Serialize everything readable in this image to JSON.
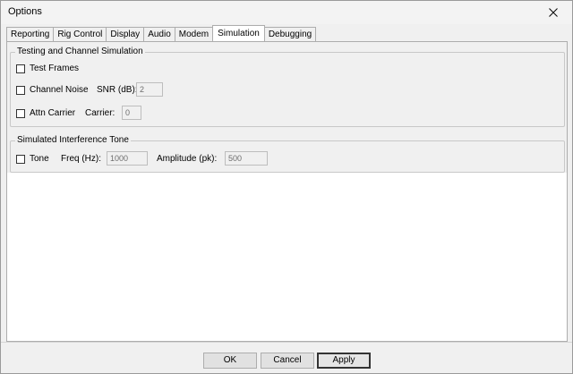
{
  "window": {
    "title": "Options"
  },
  "icons": {
    "close": "close-icon"
  },
  "tabs": [
    {
      "label": "Reporting"
    },
    {
      "label": "Rig Control"
    },
    {
      "label": "Display"
    },
    {
      "label": "Audio"
    },
    {
      "label": "Modem"
    },
    {
      "label": "Simulation",
      "active": true
    },
    {
      "label": "Debugging"
    }
  ],
  "testing": {
    "group_label": "Testing and Channel Simulation",
    "test_frames_label": "Test Frames",
    "channel_noise_label": "Channel Noise",
    "snr_label": "SNR (dB):",
    "snr_value": "2",
    "attn_carrier_label": "Attn Carrier",
    "carrier_label": "Carrier:",
    "carrier_value": "0"
  },
  "interference": {
    "group_label": "Simulated Interference Tone",
    "tone_label": "Tone",
    "freq_label": "Freq (Hz):",
    "freq_value": "1000",
    "amplitude_label": "Amplitude (pk):",
    "amplitude_value": "500"
  },
  "footer": {
    "ok_label": "OK",
    "cancel_label": "Cancel",
    "apply_label": "Apply"
  }
}
